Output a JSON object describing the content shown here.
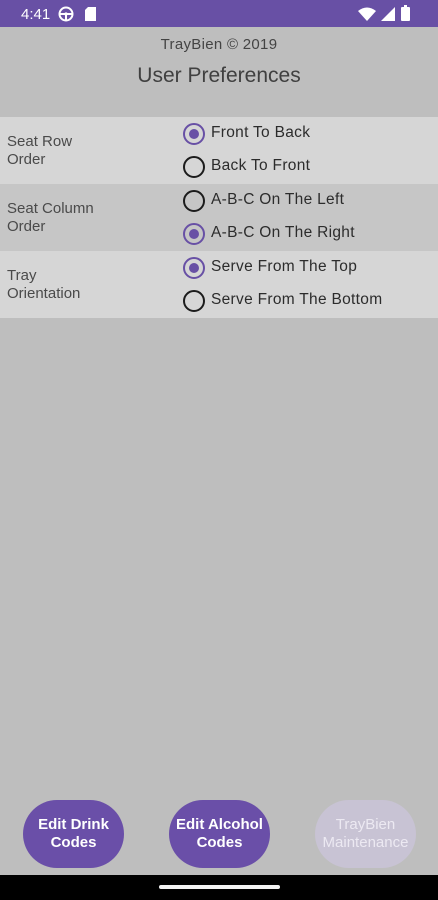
{
  "status_bar": {
    "time": "4:41",
    "icons": [
      "steering-wheel-icon",
      "sim-card-icon",
      "wifi-icon",
      "cellular-signal-icon",
      "battery-icon"
    ],
    "color": "#6850a5"
  },
  "header": {
    "subtitle": "TrayBien © 2019",
    "title": "User Preferences"
  },
  "preferences": [
    {
      "label": "Seat Row\nOrder",
      "options": [
        {
          "label": "Front To Back",
          "checked": true
        },
        {
          "label": "Back To Front",
          "checked": false
        }
      ]
    },
    {
      "label": "Seat Column\nOrder",
      "options": [
        {
          "label": "A-B-C On The Left",
          "checked": false
        },
        {
          "label": "A-B-C On The Right",
          "checked": true
        }
      ]
    },
    {
      "label": "Tray\nOrientation",
      "options": [
        {
          "label": "Serve From The Top",
          "checked": true
        },
        {
          "label": "Serve From The Bottom",
          "checked": false
        }
      ]
    }
  ],
  "buttons": {
    "edit_drink_codes": "Edit Drink\nCodes",
    "edit_alcohol_codes": "Edit Alcohol\nCodes",
    "maintenance": "TrayBien\nMaintenance",
    "maintenance_enabled": false
  },
  "colors": {
    "accent": "#6850a5",
    "background": "#bebebe",
    "row_light": "#d6d6d6",
    "row_dark": "#c6c6c6"
  }
}
